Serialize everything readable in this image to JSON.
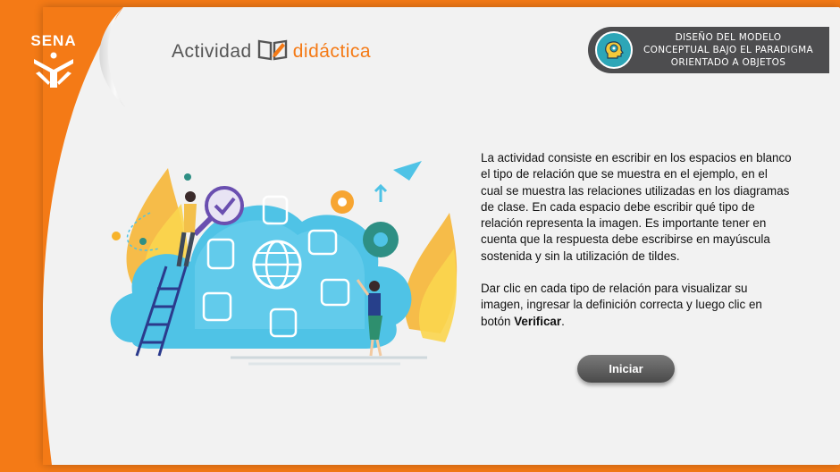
{
  "logo": {
    "text": "SENA"
  },
  "brand": {
    "word1": "Actividad",
    "word2": "didáctica",
    "book_icon": "open-book-pencil-icon"
  },
  "topic": {
    "icon": "head-gear-icon",
    "lines": [
      "DISEÑO DEL MODELO",
      "CONCEPTUAL BAJO EL PARADIGMA",
      "ORIENTADO A OBJETOS"
    ]
  },
  "description": {
    "p1": "La actividad consiste en escribir en los espacios en blanco el tipo de relación que se muestra en el ejemplo, en el cual se muestra las relaciones utilizadas en los diagramas de clase. En cada espacio debe escribir qué tipo de relación representa la imagen. Es importante tener en cuenta que la respuesta debe escribirse en mayúscula sostenida y sin la utilización de tildes.",
    "p2_before": "Dar clic en cada tipo de relación para visualizar su imagen, ingresar la definición correcta y luego clic en botón ",
    "p2_bold": "Verificar",
    "p2_after": "."
  },
  "buttons": {
    "start": "Iniciar"
  },
  "colors": {
    "orange": "#f47a16",
    "panel_dark": "#4d4d4f",
    "cloud_blue": "#4fc3e6",
    "accent_teal": "#2da6b7"
  }
}
